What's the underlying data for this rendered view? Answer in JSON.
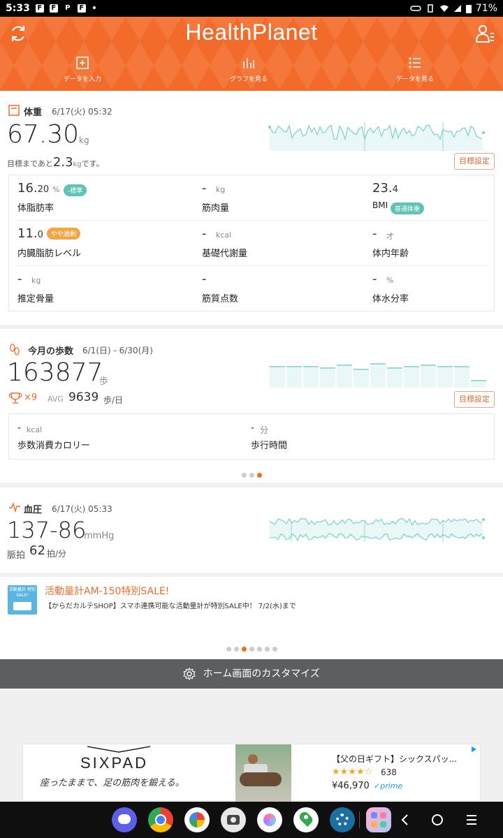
{
  "status_bar": {
    "time": "5:33",
    "notif_icons": [
      "F",
      "F",
      "P",
      "F"
    ],
    "dot": "•",
    "battery": "71%"
  },
  "header": {
    "logo": "HealthPlanet",
    "tabs": [
      {
        "label": "データを入力",
        "icon": "plus-square-icon"
      },
      {
        "label": "グラフを見る",
        "icon": "bar-graph-icon"
      },
      {
        "label": "データを見る",
        "icon": "list-icon"
      }
    ]
  },
  "weight": {
    "title": "体重",
    "date": "6/17(火) 05:32",
    "value": "67.30",
    "unit": "kg",
    "goal_prefix": "目標まであと",
    "goal_value": "2.3",
    "goal_unit": "kg",
    "goal_suffix": "です。",
    "goal_button": "目標設定",
    "metrics": [
      {
        "value": "16.",
        "value_small": "20",
        "unit": "%",
        "label": "体脂肪率",
        "badge": "-標準",
        "badge_color": "#5fc2b4"
      },
      {
        "value": "-",
        "unit": "kg",
        "label": "筋肉量"
      },
      {
        "value": "23.",
        "value_small": "4",
        "unit": "",
        "label": "BMI",
        "badge": "普通体重",
        "badge_color": "#5fc2b4"
      },
      {
        "value": "11.",
        "value_small": "0",
        "unit": "",
        "label": "内臓脂肪レベル",
        "badge": "やや過剰",
        "badge_color": "#f2a546"
      },
      {
        "value": "-",
        "unit": "kcal",
        "label": "基礎代謝量"
      },
      {
        "value": "-",
        "unit": "才",
        "label": "体内年齢"
      },
      {
        "value": "-",
        "unit": "kg",
        "label": "推定骨量"
      },
      {
        "value": "-",
        "unit": "",
        "label": "筋質点数"
      },
      {
        "value": "-",
        "unit": "%",
        "label": "体水分率"
      }
    ]
  },
  "steps": {
    "title": "今月の歩数",
    "date": "6/1(日) - 6/30(月)",
    "value": "163877",
    "unit": "歩",
    "trophy_count": "×9",
    "avg_label": "AVG",
    "avg_value": "9639",
    "avg_unit": "歩/日",
    "goal_button": "目標設定",
    "kcal_value": "-",
    "kcal_unit": "kcal",
    "kcal_label": "歩数消費カロリー",
    "time_value": "-",
    "time_unit": "分",
    "time_label": "歩行時間"
  },
  "blood_pressure": {
    "title": "血圧",
    "date": "6/17(火) 05:33",
    "value": "137-86",
    "unit": "mmHg",
    "pulse_label": "脈拍",
    "pulse_value": "62",
    "pulse_unit": "拍/分"
  },
  "promo": {
    "thumb_text": "活動量計 特別SALE!",
    "title": "活動量計AM-150特別SALE!",
    "body": "【からだカルテSHOP】スマホ連携可能な活動量計が特別SALE中！ 7/2(水)まで"
  },
  "customize_label": "ホーム画面のカスタマイズ",
  "ad": {
    "brand": "SIXPAD",
    "tagline": "座ったままで、足の筋肉を鍛える。",
    "title": "【父の日ギフト】シックスパッ...",
    "review_count": "638",
    "price": "¥46,970",
    "prime": "✓prime"
  },
  "colors": {
    "accent": "#f36b2b",
    "teal": "#5fc2b4",
    "chart_line": "#7fcfc9",
    "chart_fill": "#e9f7f6"
  }
}
